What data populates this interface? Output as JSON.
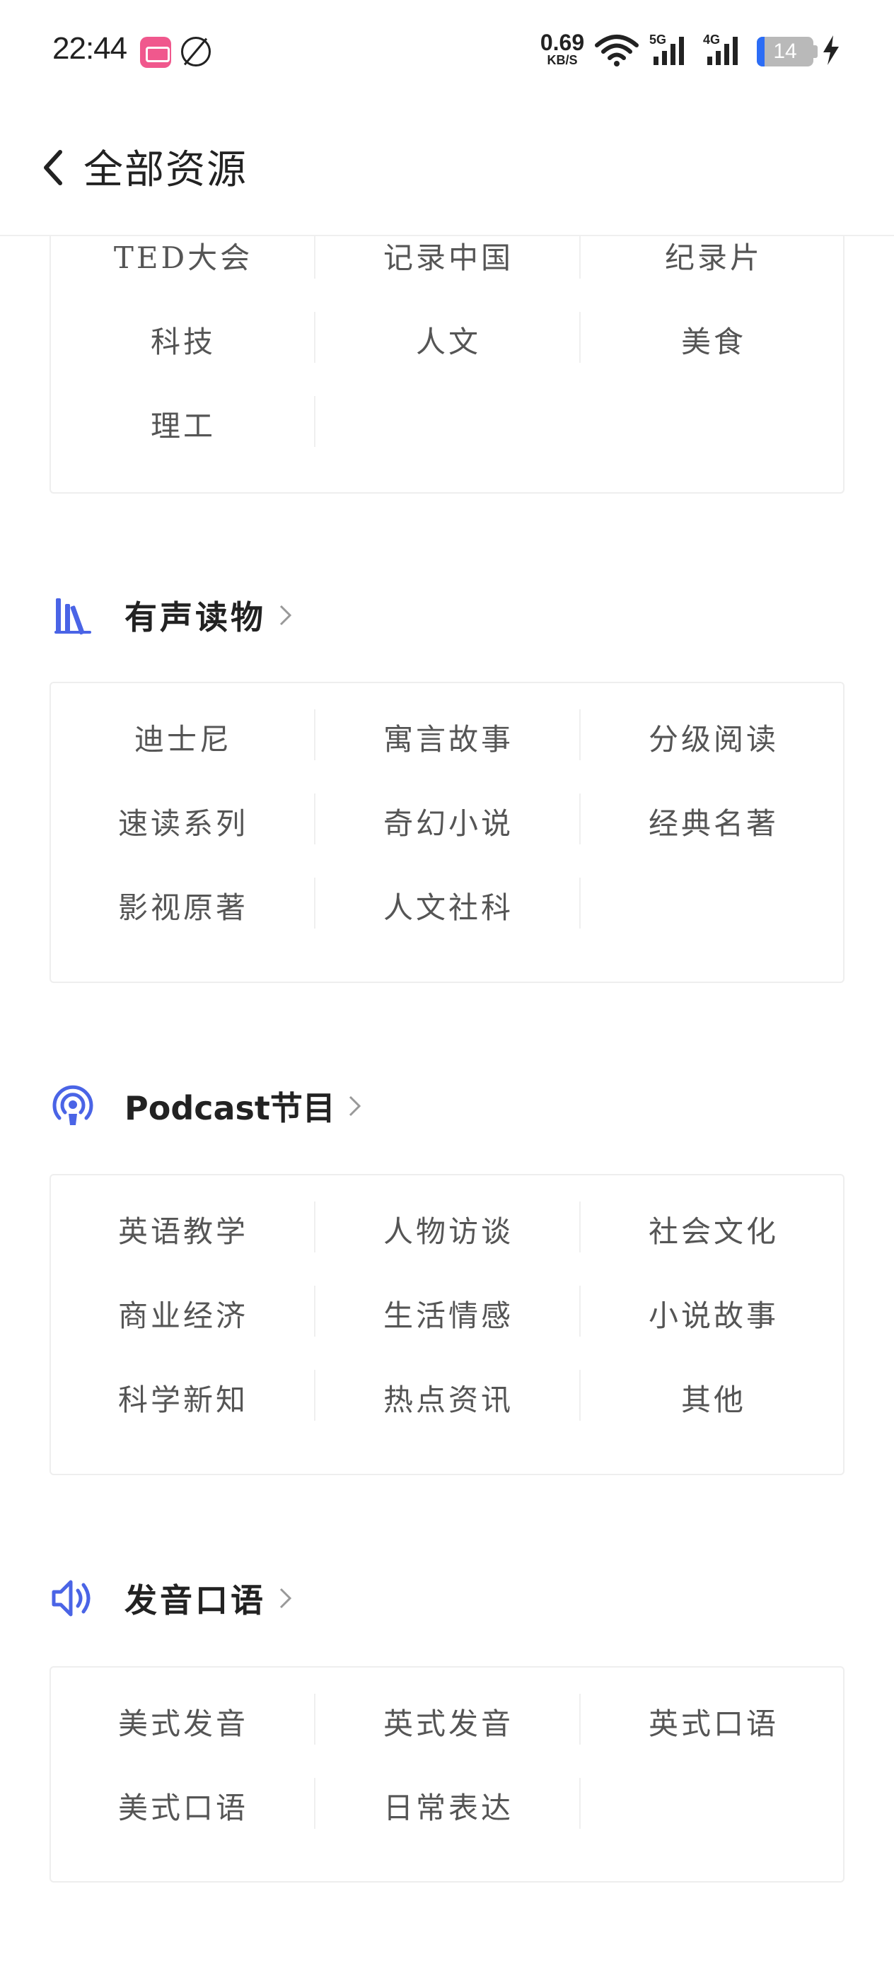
{
  "status_bar": {
    "time": "22:44",
    "net_speed_value": "0.69",
    "net_speed_unit": "KB/S",
    "signal_1_label": "5G",
    "signal_2_label": "4G",
    "battery_level": "14",
    "icons": [
      "app-notification-icon",
      "nfc-icon",
      "wifi-icon",
      "signal-5g-icon",
      "signal-4g-icon",
      "battery-icon",
      "charging-icon"
    ]
  },
  "nav": {
    "title": "全部资源",
    "back_icon": "chevron-left-icon"
  },
  "colors": {
    "accent": "#4a64e6",
    "text_item": "#555555",
    "title": "#222222",
    "border": "#eeeeee"
  },
  "sections": [
    {
      "id": "video",
      "title": null,
      "items": [
        "TED大会",
        "记录中国",
        "纪录片",
        "科技",
        "人文",
        "美食",
        "理工"
      ]
    },
    {
      "id": "audiobooks",
      "title": "有声读物",
      "icon": "books-icon",
      "items": [
        "迪士尼",
        "寓言故事",
        "分级阅读",
        "速读系列",
        "奇幻小说",
        "经典名著",
        "影视原著",
        "人文社科"
      ]
    },
    {
      "id": "podcast",
      "title": "Podcast节目",
      "icon": "podcast-icon",
      "items": [
        "英语教学",
        "人物访谈",
        "社会文化",
        "商业经济",
        "生活情感",
        "小说故事",
        "科学新知",
        "热点资讯",
        "其他"
      ]
    },
    {
      "id": "pronunciation",
      "title": "发音口语",
      "icon": "speaker-icon",
      "items": [
        "美式发音",
        "英式发音",
        "英式口语",
        "美式口语",
        "日常表达"
      ]
    }
  ]
}
